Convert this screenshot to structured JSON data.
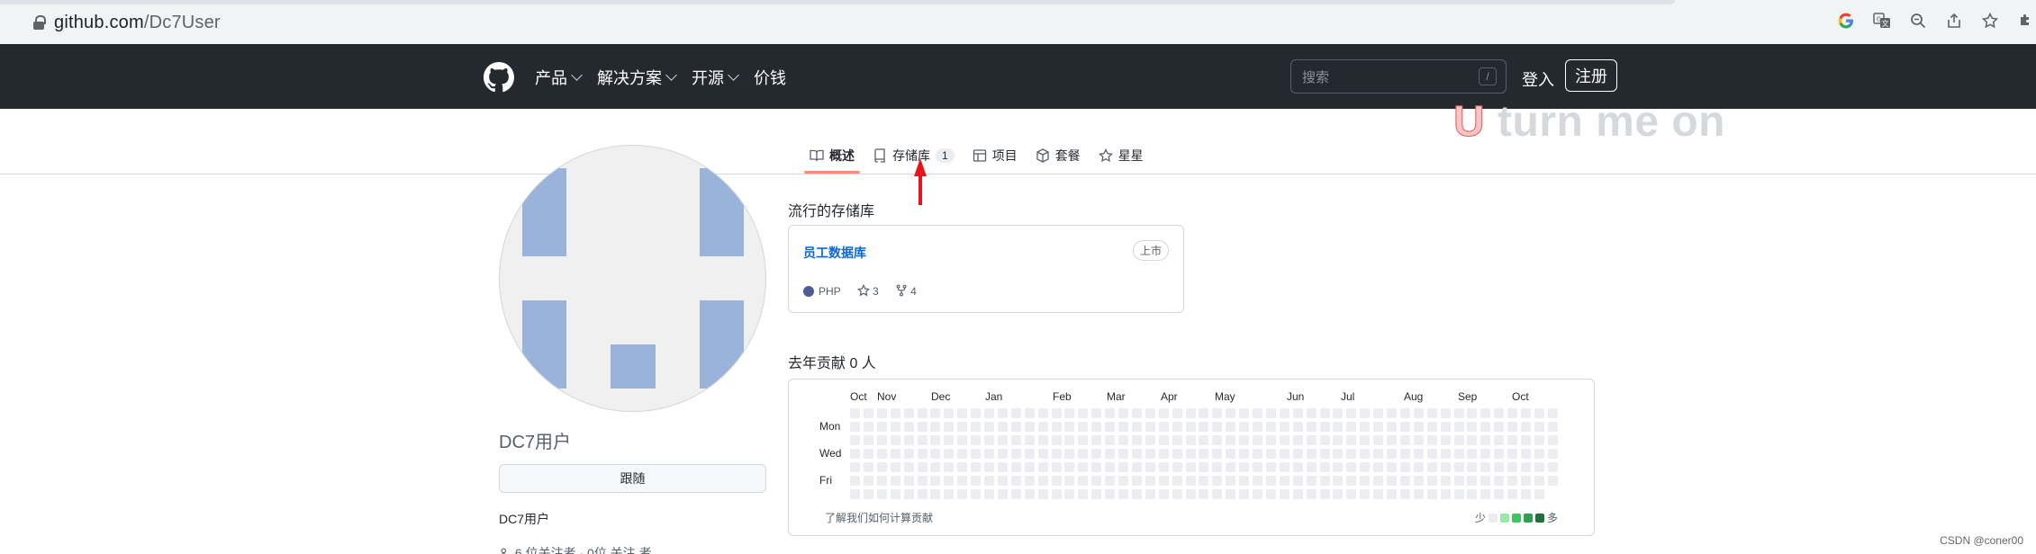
{
  "browser": {
    "url_host": "github.com",
    "url_path": "/Dc7User"
  },
  "header": {
    "nav": [
      {
        "label": "产品",
        "has_menu": true
      },
      {
        "label": "解决方案",
        "has_menu": true
      },
      {
        "label": "开源",
        "has_menu": true
      },
      {
        "label": "价钱",
        "has_menu": false
      }
    ],
    "search_placeholder": "搜索",
    "search_shortcut": "/",
    "signin_label": "登入",
    "signup_label": "注册"
  },
  "tabs": [
    {
      "label": "概述",
      "icon": "book-icon",
      "active": true
    },
    {
      "label": "存储库",
      "icon": "repo-icon",
      "count": "1",
      "active": false
    },
    {
      "label": "项目",
      "icon": "table-icon",
      "active": false
    },
    {
      "label": "套餐",
      "icon": "package-icon",
      "active": false
    },
    {
      "label": "星星",
      "icon": "star-icon",
      "active": false
    }
  ],
  "overlay_text": {
    "first": "U",
    "rest": " turn me on"
  },
  "profile": {
    "name": "DC7用户",
    "follow_label": "跟随",
    "bio": "DC7用户",
    "followers_text": "6 位关注者 · 0位 关注 者"
  },
  "popular": {
    "title": "流行的存储库",
    "repo": {
      "name": "员工数据库",
      "badge": "上市",
      "language": "PHP",
      "language_color": "#4f5d95",
      "stars": "3",
      "forks": "4"
    }
  },
  "contributions": {
    "title": "去年贡献 0 人",
    "months": [
      "Oct",
      "Nov",
      "Dec",
      "Jan",
      "Feb",
      "Mar",
      "Apr",
      "May",
      "Jun",
      "Jul",
      "Aug",
      "Sep",
      "Oct"
    ],
    "days": [
      "Mon",
      "Wed",
      "Fri"
    ],
    "learn_link": "了解我们如何计算贡献",
    "legend_less": "少",
    "legend_more": "多",
    "legend_colors": [
      "#ebedf0",
      "#9be9a8",
      "#40c463",
      "#30a14e",
      "#216e39"
    ]
  },
  "watermark": "CSDN @coner00"
}
